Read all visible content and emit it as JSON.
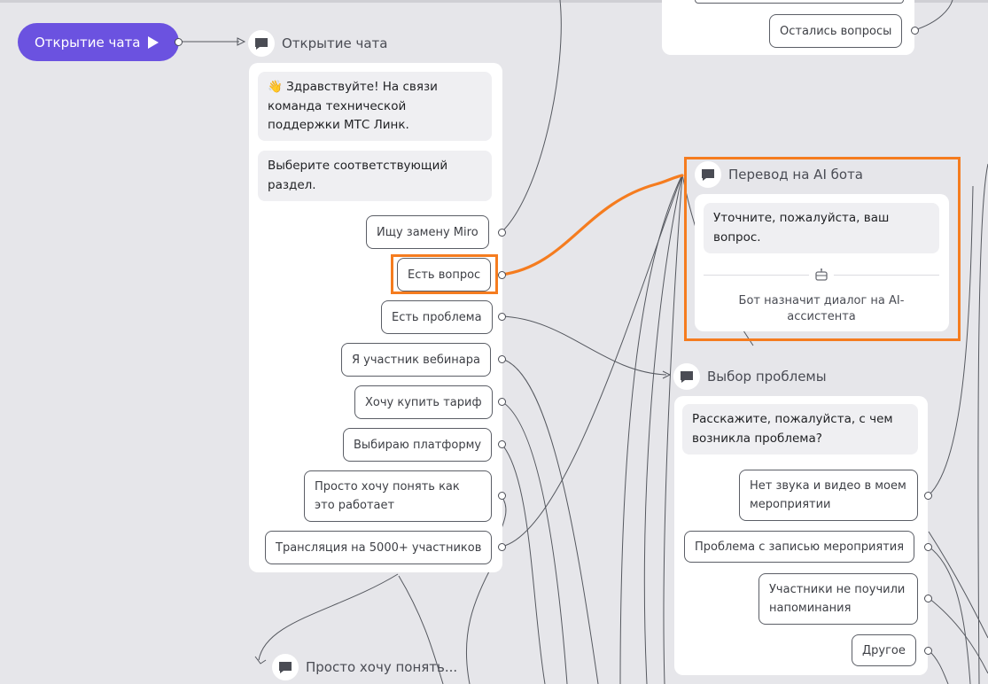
{
  "start": {
    "label": "Открытие чата"
  },
  "nodes": {
    "greeting": {
      "title": "Открытие чата",
      "messages": [
        "👋 Здравствуйте! На связи команда технической поддержки МТС Линк.",
        "Выберите соответствующий раздел."
      ],
      "options": [
        "Ищу замену Miro",
        "Есть вопрос",
        "Есть проблема",
        "Я участник вебинара",
        "Хочу купить тариф",
        "Выбираю платформу",
        "Просто хочу понять как это работает",
        "Трансляция на 5000+ участников"
      ]
    },
    "top_right": {
      "options": [
        "Остались вопросы"
      ]
    },
    "ai_bot": {
      "title": "Перевод на AI бота",
      "message": "Уточните, пожалуйста, ваш вопрос.",
      "note": "Бот назначит диалог на AI-ассистента"
    },
    "problem": {
      "title": "Выбор проблемы",
      "message": "Расскажите, пожалуйста, с чем возникла проблема?",
      "options": [
        "Нет звука и видео в моем мероприятии",
        "Проблема с записью мероприятия",
        "Участники не поучили напоминания",
        "Другое"
      ]
    },
    "understand": {
      "title": "Просто хочу понять..."
    }
  },
  "colors": {
    "canvas": "#e6e6ea",
    "accent": "#6b52e0",
    "highlight": "#f57c1f",
    "edge": "#55585f"
  }
}
